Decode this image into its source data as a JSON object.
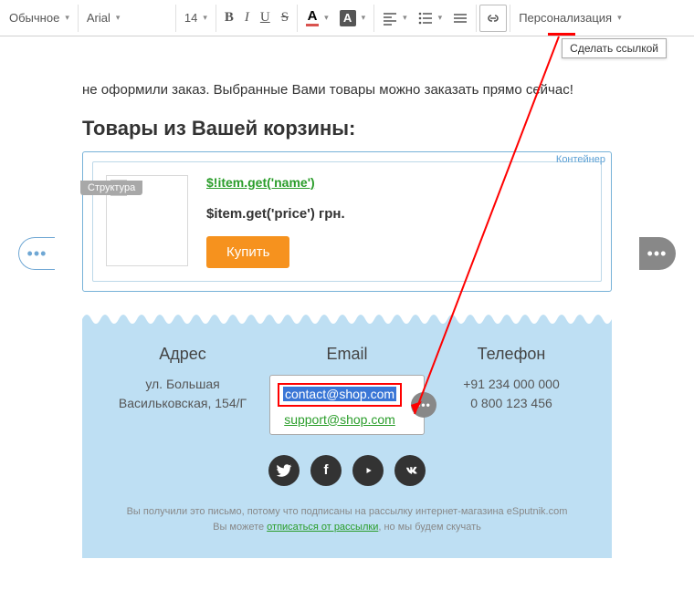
{
  "toolbar": {
    "style_label": "Обычное",
    "font_label": "Arial",
    "size_label": "14",
    "personalization": "Персонализация"
  },
  "tooltip": "Сделать ссылкой",
  "labels": {
    "structure": "Структура",
    "container": "Контейнер"
  },
  "body": {
    "text": "не оформили заказ. Выбранные Вами товары можно заказать прямо сейчас!",
    "heading": "Товары из Вашей корзины:"
  },
  "product": {
    "name": "$!item.get('name')",
    "price": "$item.get('price') грн.",
    "buy": "Купить"
  },
  "footer": {
    "address_head": "Адрес",
    "address_lines": "ул. Большая Васильковская, 154/Г",
    "email_head": "Email",
    "email1": "contact@shop.com",
    "email2": "support@shop.com",
    "phone_head": "Телефон",
    "phone1": "+91 234 000 000",
    "phone2": "0 800 123 456"
  },
  "footnote": {
    "line1": "Вы получили это письмо, потому что подписаны на рассылку интернет-магазина eSputnik.com",
    "line2a": "Вы можете ",
    "unsubscribe": "отписаться от рассылки",
    "line2b": ", но мы будем скучать"
  }
}
